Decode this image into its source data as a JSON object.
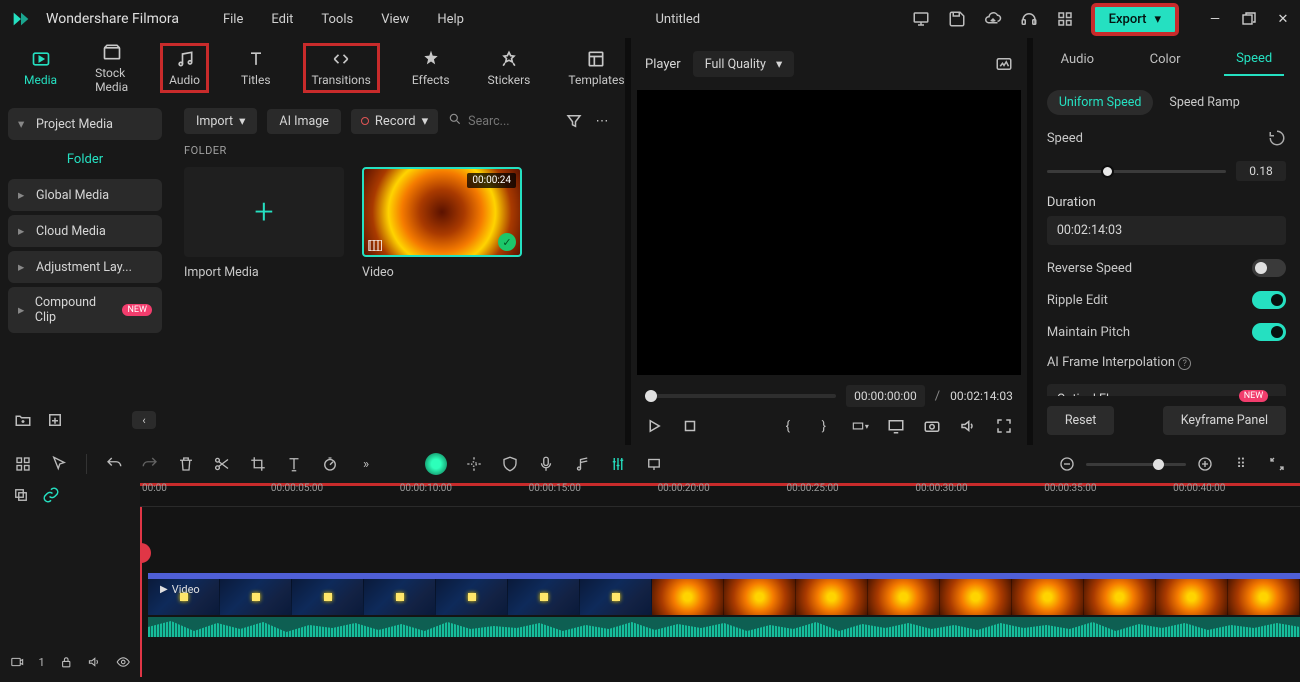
{
  "app": {
    "name": "Wondershare Filmora",
    "title": "Untitled"
  },
  "menu": [
    "File",
    "Edit",
    "Tools",
    "View",
    "Help"
  ],
  "export_label": "Export",
  "tabs": [
    {
      "label": "Media",
      "active": true
    },
    {
      "label": "Stock Media"
    },
    {
      "label": "Audio",
      "red": true
    },
    {
      "label": "Titles"
    },
    {
      "label": "Transitions",
      "red": true
    },
    {
      "label": "Effects"
    },
    {
      "label": "Stickers"
    },
    {
      "label": "Templates"
    }
  ],
  "sidebar": {
    "items": [
      {
        "label": "Project Media",
        "expanded": true
      },
      {
        "label": "Global Media"
      },
      {
        "label": "Cloud Media"
      },
      {
        "label": "Adjustment Lay..."
      },
      {
        "label": "Compound Clip",
        "new": true
      }
    ],
    "folder_label": "Folder"
  },
  "toolbar": {
    "import": "Import",
    "ai_image": "AI Image",
    "record": "Record",
    "search_placeholder": "Searc..."
  },
  "mediaarea": {
    "folder_header": "FOLDER",
    "import_label": "Import Media",
    "video_label": "Video",
    "video_duration": "00:00:24"
  },
  "player": {
    "label": "Player",
    "quality": "Full Quality",
    "current": "00:00:00:00",
    "total": "00:02:14:03"
  },
  "right": {
    "tabs": [
      "Audio",
      "Color",
      "Speed"
    ],
    "active_tab": "Speed",
    "uniform": "Uniform Speed",
    "ramp": "Speed Ramp",
    "speed_label": "Speed",
    "speed_value": "0.18",
    "duration_label": "Duration",
    "duration_value": "00:02:14:03",
    "reverse": "Reverse Speed",
    "ripple": "Ripple Edit",
    "pitch": "Maintain Pitch",
    "aiframe": "AI Frame Interpolation",
    "optical": "Optical Flow",
    "reset": "Reset",
    "keyframe": "Keyframe Panel",
    "new": "NEW"
  },
  "timeline": {
    "ticks": [
      "00:00",
      "00:00:05:00",
      "00:00:10:00",
      "00:00:15:00",
      "00:00:20:00",
      "00:00:25:00",
      "00:00:30:00",
      "00:00:35:00",
      "00:00:40:00"
    ],
    "video_label": "Video",
    "track_badge": "1"
  }
}
